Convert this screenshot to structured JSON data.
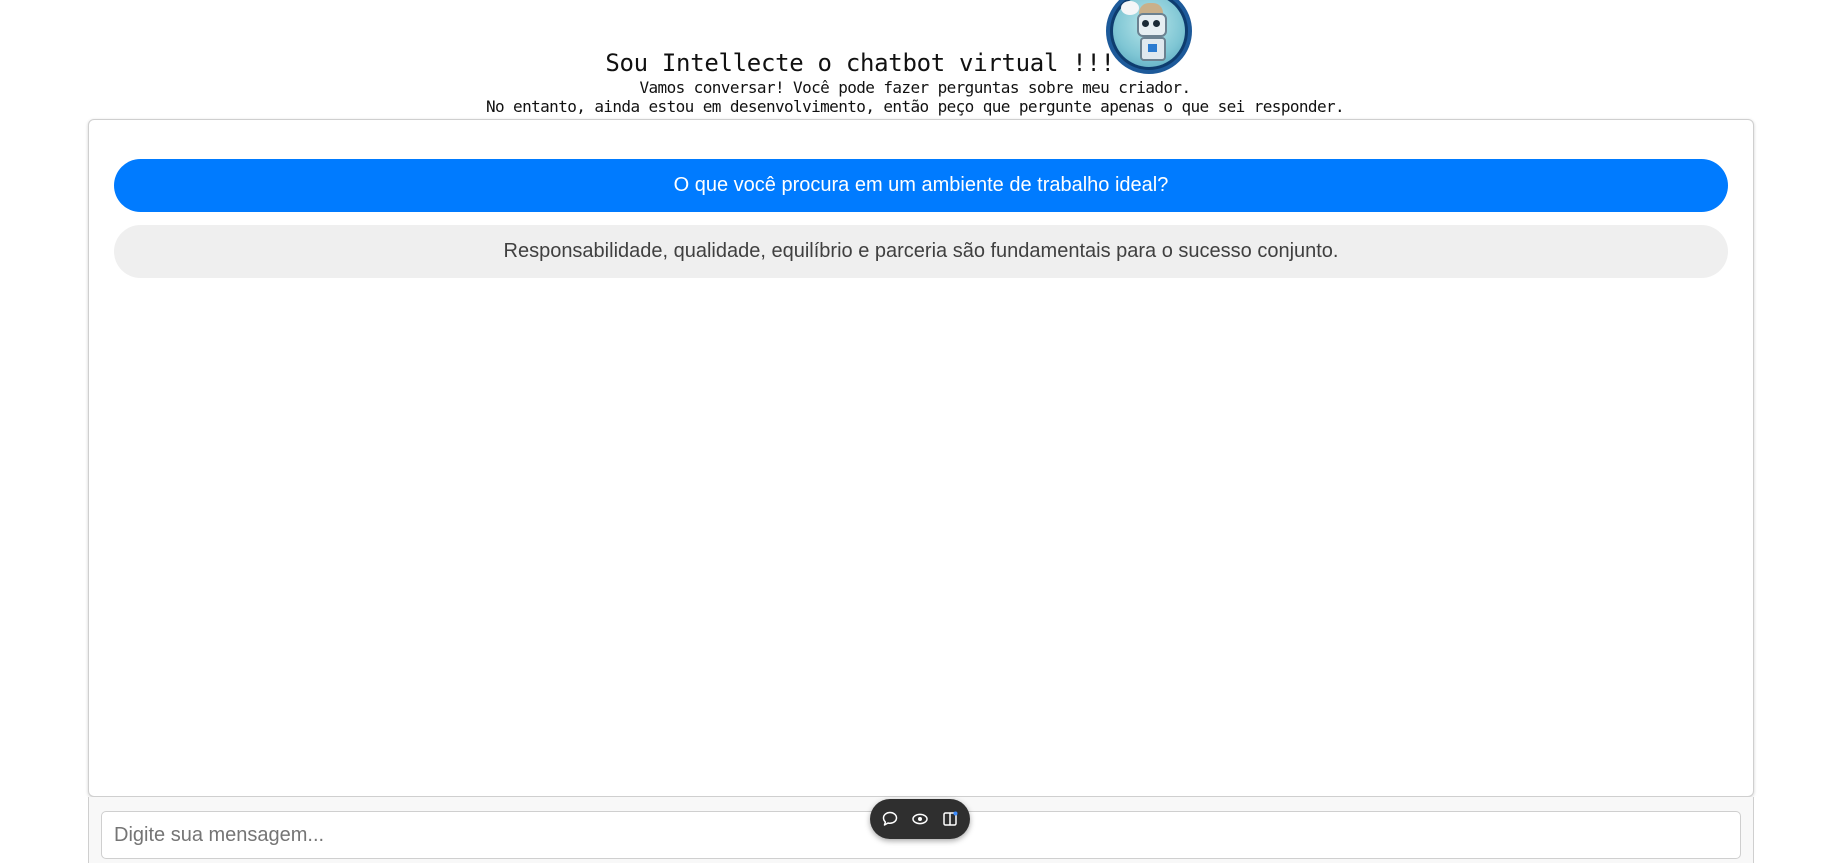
{
  "header": {
    "title": "Sou Intellecte o chatbot virtual !!!",
    "subtitle_line1": "Vamos conversar! Você pode fazer perguntas sobre meu criador.",
    "subtitle_line2": "No entanto, ainda estou em desenvolvimento, então peço que pergunte apenas o que sei responder.",
    "avatar_icon": "robot-avatar-icon"
  },
  "chat": {
    "messages": [
      {
        "role": "user",
        "text": "O que você procura em um ambiente de trabalho ideal?"
      },
      {
        "role": "bot",
        "text": "Responsabilidade, qualidade, equilíbrio e parceria são fundamentais para o sucesso conjunto."
      }
    ]
  },
  "input": {
    "placeholder": "Digite sua mensagem...",
    "value": ""
  },
  "toolbar": {
    "icons": [
      "comment-icon",
      "eye-icon",
      "panel-icon"
    ]
  },
  "colors": {
    "user_bubble": "#007bff",
    "bot_bubble": "#efefef",
    "toolbar_bg": "#2f2f2f"
  }
}
